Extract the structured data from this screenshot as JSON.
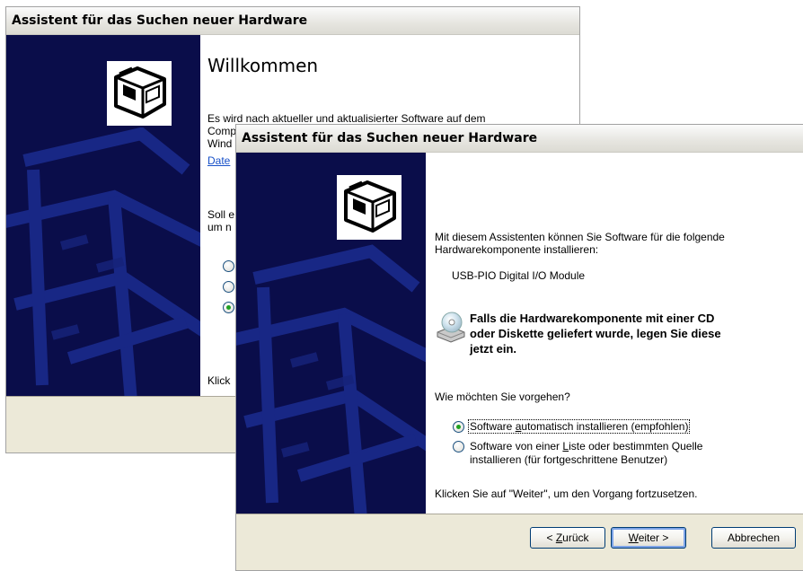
{
  "back_window": {
    "title": "Assistent für das Suchen neuer Hardware",
    "heading": "Willkommen",
    "intro_line1": "Es wird nach aktueller und aktualisierter Software auf dem",
    "intro_line2": "Comp",
    "intro_line3": "Wind",
    "link_fragment": "Date",
    "question_line1": "Soll e",
    "question_line2": "um n",
    "footer_fragment": "Klick"
  },
  "front_window": {
    "title": "Assistent für das Suchen neuer Hardware",
    "intro_line1": "Mit diesem Assistenten können Sie Software für die folgende",
    "intro_line2": "Hardwarekomponente installieren:",
    "device_name": "USB-PIO Digital I/O Module",
    "cd_notice_line1": "Falls die Hardwarekomponente mit einer CD",
    "cd_notice_line2": "oder Diskette geliefert wurde, legen Sie diese",
    "cd_notice_line3": "jetzt ein.",
    "question": "Wie möchten Sie vorgehen?",
    "options": [
      {
        "pre": "Software ",
        "accel": "a",
        "post": "utomatisch installieren (empfohlen)",
        "selected": true
      },
      {
        "pre": "Software von einer ",
        "accel": "L",
        "post": "iste oder bestimmten Quelle",
        "line2": "installieren (für fortgeschrittene Benutzer)",
        "selected": false
      }
    ],
    "continue_hint": "Klicken Sie auf \"Weiter\", um den Vorgang fortzusetzen.",
    "buttons": {
      "back": {
        "pre": "< ",
        "accel": "Z",
        "post": "urück"
      },
      "next": {
        "pre": "",
        "accel": "W",
        "post": "eiter >"
      },
      "cancel": "Abbrechen"
    }
  },
  "icons": {
    "wizard": "hardware-wizard-icon",
    "cd": "cd-drive-icon"
  },
  "colors": {
    "side_panel": "#0a0d4a",
    "link": "#1750c8",
    "radio_dot": "#21a121",
    "button_border": "#003c74"
  }
}
